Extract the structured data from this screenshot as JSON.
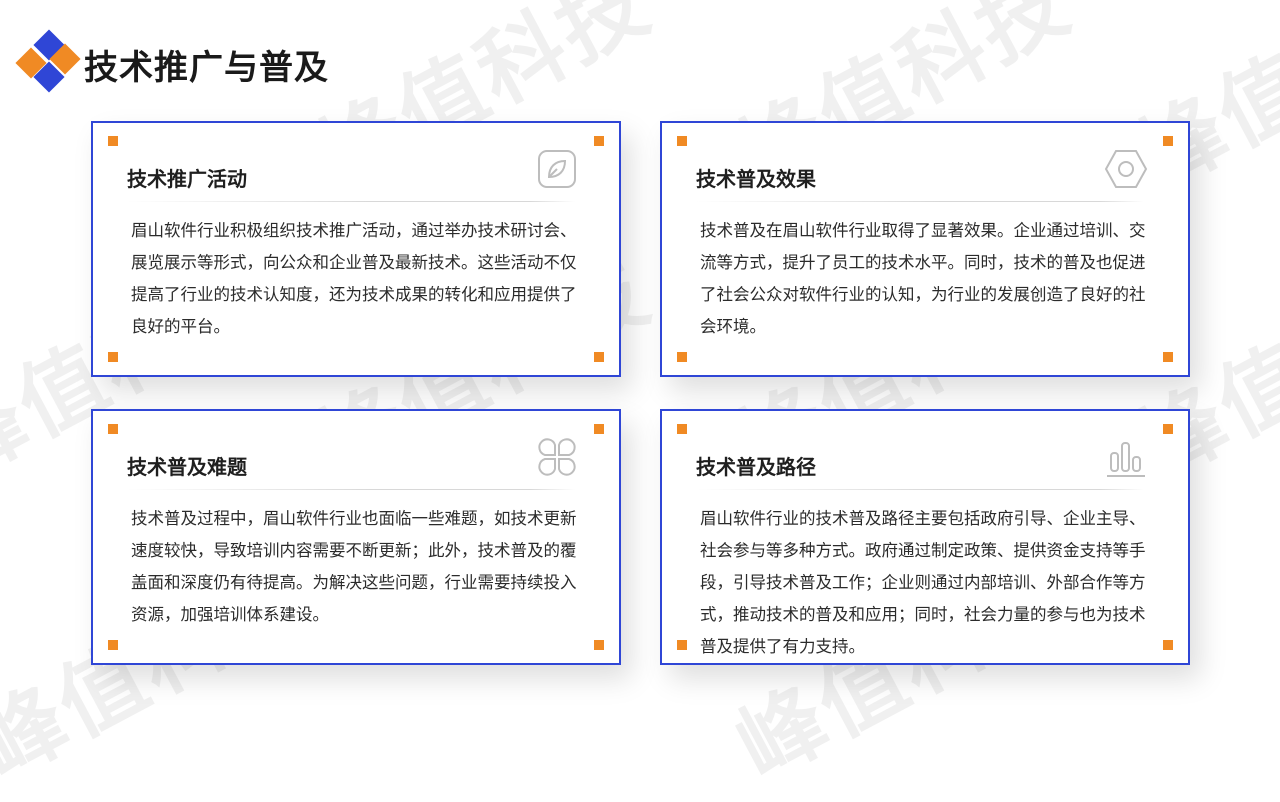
{
  "page": {
    "title": "技术推广与普及",
    "watermark_text": "峰值科技"
  },
  "colors": {
    "accent_blue": "#2f46d6",
    "accent_orange": "#f08a24",
    "logo_blue": "#2f46d6",
    "logo_orange": "#f08a24"
  },
  "cards": [
    {
      "title": "技术推广活动",
      "icon": "leaf-icon",
      "body": "眉山软件行业积极组织技术推广活动，通过举办技术研讨会、展览展示等形式，向公众和企业普及最新技术。这些活动不仅提高了行业的技术认知度，还为技术成果的转化和应用提供了良好的平台。"
    },
    {
      "title": "技术普及效果",
      "icon": "hexagon-nut-icon",
      "body": "技术普及在眉山软件行业取得了显著效果。企业通过培训、交流等方式，提升了员工的技术水平。同时，技术的普及也促进了社会公众对软件行业的认知，为行业的发展创造了良好的社会环境。"
    },
    {
      "title": "技术普及难题",
      "icon": "four-petal-icon",
      "body": "技术普及过程中，眉山软件行业也面临一些难题，如技术更新速度较快，导致培训内容需要不断更新；此外，技术普及的覆盖面和深度仍有待提高。为解决这些问题，行业需要持续投入资源，加强培训体系建设。"
    },
    {
      "title": "技术普及路径",
      "icon": "bar-chart-icon",
      "body": "眉山软件行业的技术普及路径主要包括政府引导、企业主导、社会参与等多种方式。政府通过制定政策、提供资金支持等手段，引导技术普及工作；企业则通过内部培训、外部合作等方式，推动技术的普及和应用；同时，社会力量的参与也为技术普及提供了有力支持。"
    }
  ]
}
